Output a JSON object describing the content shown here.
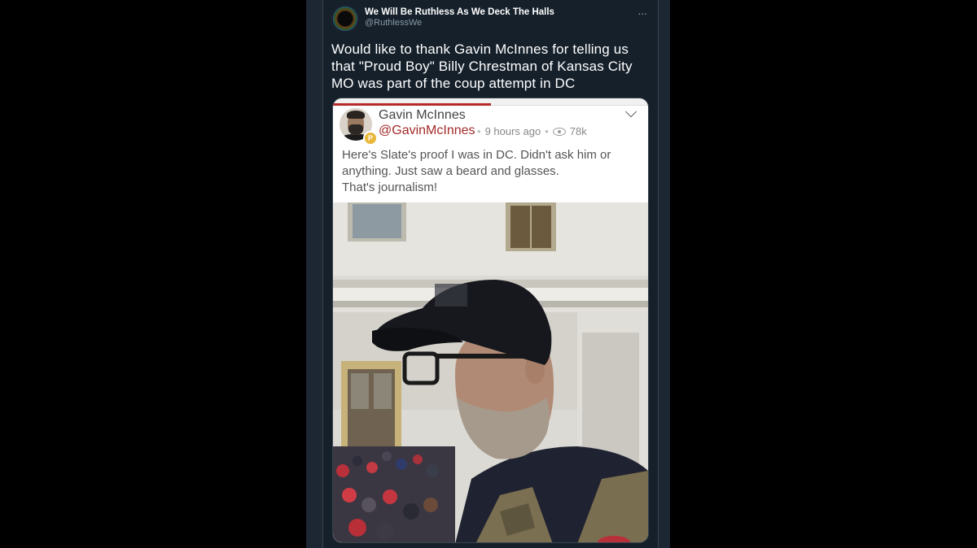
{
  "tweet": {
    "display_name": "We Will Be Ruthless As We Deck The Halls",
    "handle": "@RuthlessWe",
    "more_icon": "ellipsis-icon",
    "text": "Would like to thank Gavin McInnes for telling us that \"Proud Boy\" Billy Chrestman of Kansas City MO was part of the coup attempt in DC"
  },
  "embedded_post": {
    "author_name": "Gavin McInnes",
    "author_handle": "@GavinMcInnes",
    "time_ago": "9 hours ago",
    "views": "78k",
    "body": "Here's Slate's proof I was in DC. Didn't ask him or\nanything. Just saw a beard and glasses.\nThat's journalism!",
    "handle_color": "#a42a2a",
    "accent_color": "#b52a2a"
  },
  "colors": {
    "page_bg": "#000000",
    "tweet_bg": "#15202b",
    "text_primary": "#ffffff",
    "text_secondary": "#8899a6"
  }
}
